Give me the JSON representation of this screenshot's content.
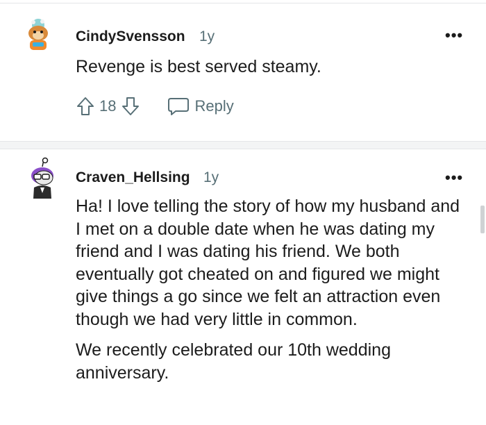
{
  "comments": [
    {
      "username": "CindySvensson",
      "age": "1y",
      "text": [
        "Revenge is best served steamy."
      ],
      "score": "18",
      "reply_label": "Reply"
    },
    {
      "username": "Craven_Hellsing",
      "age": "1y",
      "text": [
        "Ha! I love telling the story of how my husband and I met on a double date when he was dating my friend and I was dating his friend. We both eventually got cheated on and figured we might give things a go since we felt an attraction even though we had very little in common.",
        "We recently celebrated our 10th wedding anniversary."
      ]
    }
  ],
  "icons": {
    "more": "overflow-menu-icon",
    "upvote": "arrow-up-icon",
    "downvote": "arrow-down-icon",
    "reply": "speech-bubble-icon"
  },
  "colors": {
    "text": "#1c1c1c",
    "meta": "#576f76",
    "divider": "#e4e6e8"
  }
}
